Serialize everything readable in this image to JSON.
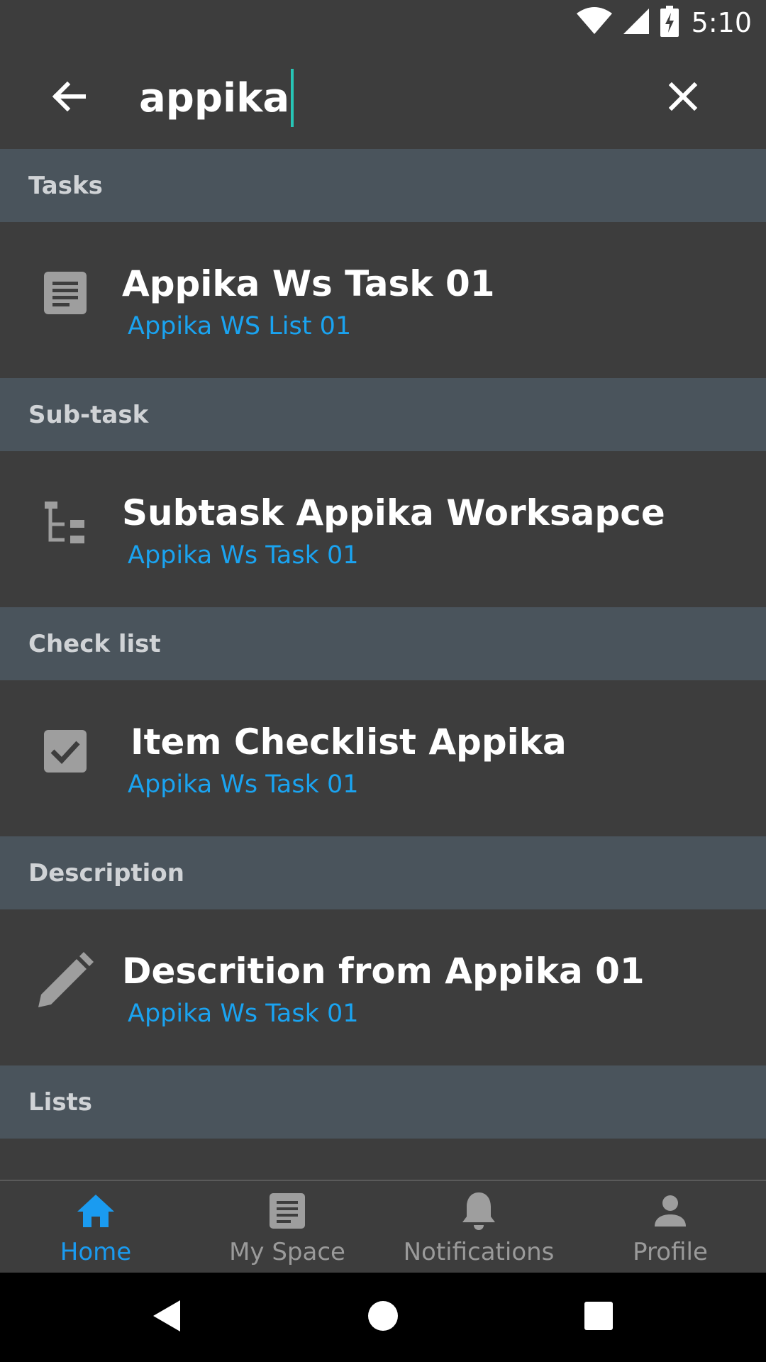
{
  "status_bar": {
    "time": "5:10",
    "icons": [
      "wifi-icon",
      "signal-icon",
      "battery-charging-icon"
    ]
  },
  "search": {
    "query": "appika",
    "back_icon": "arrow-left-icon",
    "clear_icon": "close-icon"
  },
  "sections": [
    {
      "title": "Tasks",
      "items": [
        {
          "icon": "document-icon",
          "title": "Appika Ws Task 01",
          "subtitle": "Appika WS List 01"
        }
      ]
    },
    {
      "title": "Sub-task",
      "items": [
        {
          "icon": "subtask-tree-icon",
          "title": "Subtask Appika Worksapce",
          "subtitle": "Appika Ws Task 01"
        }
      ]
    },
    {
      "title": "Check list",
      "items": [
        {
          "icon": "checkbox-icon",
          "title": "Item Checklist Appika",
          "subtitle": "Appika Ws Task 01"
        }
      ]
    },
    {
      "title": "Description",
      "items": [
        {
          "icon": "pencil-icon",
          "title": "Descrition from Appika 01",
          "subtitle": "Appika Ws Task 01"
        }
      ]
    },
    {
      "title": "Lists",
      "items": []
    }
  ],
  "bottom_nav": {
    "active": "Home",
    "items": [
      {
        "label": "Home",
        "icon": "home-icon"
      },
      {
        "label": "My Space",
        "icon": "document-icon"
      },
      {
        "label": "Notifications",
        "icon": "bell-icon"
      },
      {
        "label": "Profile",
        "icon": "person-icon"
      }
    ]
  },
  "colors": {
    "background": "#3d3d3d",
    "section_header": "#4a545c",
    "accent": "#1a9bf0",
    "caret": "#27c5b6"
  }
}
